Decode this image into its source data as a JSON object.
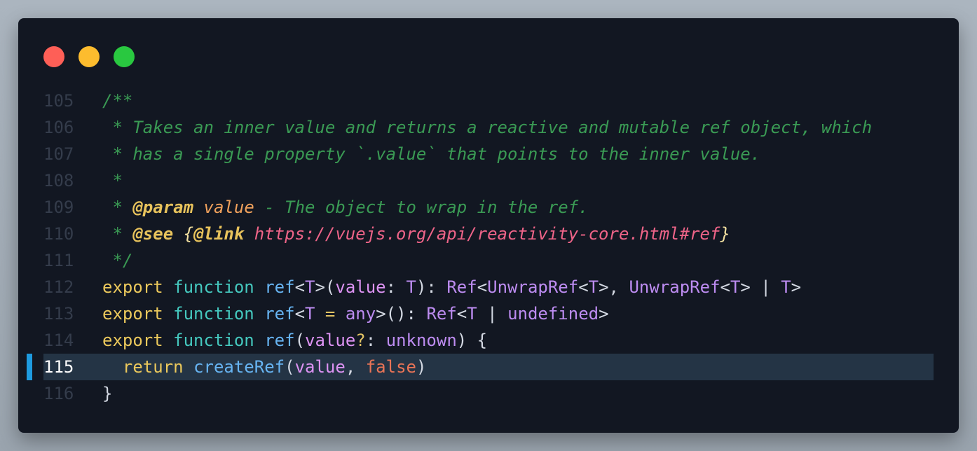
{
  "window": {
    "controls": [
      "close",
      "minimize",
      "maximize"
    ],
    "active_line": 115
  },
  "colors": {
    "background": "#121722",
    "line_highlight": "#243445",
    "gutter_marker": "#1e9be0",
    "comment": "#3a9a54",
    "keyword": "#ecc95c",
    "storage": "#45c9bf",
    "function": "#67b4f2",
    "type": "#bd8cf1",
    "variable": "#dd93f3",
    "boolean": "#ea7456",
    "url": "#ee6488"
  },
  "lines": [
    {
      "number": "105",
      "tokens": [
        {
          "text": "/**",
          "kind": "comment"
        }
      ]
    },
    {
      "number": "106",
      "tokens": [
        {
          "text": " * Takes an inner value and returns a reactive and mutable ref object, which",
          "kind": "comment"
        }
      ]
    },
    {
      "number": "107",
      "tokens": [
        {
          "text": " * has a single property `.value` that points to the inner value.",
          "kind": "comment"
        }
      ]
    },
    {
      "number": "108",
      "tokens": [
        {
          "text": " *",
          "kind": "comment"
        }
      ]
    },
    {
      "number": "109",
      "tokens": [
        {
          "text": " * ",
          "kind": "comment"
        },
        {
          "text": "@param",
          "kind": "doctag"
        },
        {
          "text": " ",
          "kind": "comment"
        },
        {
          "text": "value",
          "kind": "param"
        },
        {
          "text": " - The object to wrap in the ref.",
          "kind": "comment"
        }
      ]
    },
    {
      "number": "110",
      "tokens": [
        {
          "text": " * ",
          "kind": "comment"
        },
        {
          "text": "@see",
          "kind": "doctag"
        },
        {
          "text": " ",
          "kind": "comment"
        },
        {
          "text": "{",
          "kind": "brace"
        },
        {
          "text": "@link",
          "kind": "doctag"
        },
        {
          "text": " ",
          "kind": "comment"
        },
        {
          "text": "https://vuejs.org/api/reactivity-core.html#ref",
          "kind": "url"
        },
        {
          "text": "}",
          "kind": "brace"
        }
      ]
    },
    {
      "number": "111",
      "tokens": [
        {
          "text": " */",
          "kind": "comment"
        }
      ]
    },
    {
      "number": "112",
      "tokens": [
        {
          "text": "export",
          "kind": "keyword"
        },
        {
          "text": " ",
          "kind": "plain"
        },
        {
          "text": "function",
          "kind": "storage"
        },
        {
          "text": " ",
          "kind": "plain"
        },
        {
          "text": "ref",
          "kind": "func"
        },
        {
          "text": "<",
          "kind": "punct"
        },
        {
          "text": "T",
          "kind": "type"
        },
        {
          "text": ">(",
          "kind": "punct"
        },
        {
          "text": "value",
          "kind": "var"
        },
        {
          "text": ": ",
          "kind": "punct"
        },
        {
          "text": "T",
          "kind": "type"
        },
        {
          "text": "): ",
          "kind": "punct"
        },
        {
          "text": "Ref",
          "kind": "type"
        },
        {
          "text": "<",
          "kind": "punct"
        },
        {
          "text": "UnwrapRef",
          "kind": "type"
        },
        {
          "text": "<",
          "kind": "punct"
        },
        {
          "text": "T",
          "kind": "type"
        },
        {
          "text": ">, ",
          "kind": "punct"
        },
        {
          "text": "UnwrapRef",
          "kind": "type"
        },
        {
          "text": "<",
          "kind": "punct"
        },
        {
          "text": "T",
          "kind": "type"
        },
        {
          "text": "> | ",
          "kind": "punct"
        },
        {
          "text": "T",
          "kind": "type"
        },
        {
          "text": ">",
          "kind": "punct"
        }
      ]
    },
    {
      "number": "113",
      "tokens": [
        {
          "text": "export",
          "kind": "keyword"
        },
        {
          "text": " ",
          "kind": "plain"
        },
        {
          "text": "function",
          "kind": "storage"
        },
        {
          "text": " ",
          "kind": "plain"
        },
        {
          "text": "ref",
          "kind": "func"
        },
        {
          "text": "<",
          "kind": "punct"
        },
        {
          "text": "T",
          "kind": "type"
        },
        {
          "text": " ",
          "kind": "plain"
        },
        {
          "text": "=",
          "kind": "op"
        },
        {
          "text": " ",
          "kind": "plain"
        },
        {
          "text": "any",
          "kind": "type"
        },
        {
          "text": ">(): ",
          "kind": "punct"
        },
        {
          "text": "Ref",
          "kind": "type"
        },
        {
          "text": "<",
          "kind": "punct"
        },
        {
          "text": "T",
          "kind": "type"
        },
        {
          "text": " | ",
          "kind": "punct"
        },
        {
          "text": "undefined",
          "kind": "type"
        },
        {
          "text": ">",
          "kind": "punct"
        }
      ]
    },
    {
      "number": "114",
      "tokens": [
        {
          "text": "export",
          "kind": "keyword"
        },
        {
          "text": " ",
          "kind": "plain"
        },
        {
          "text": "function",
          "kind": "storage"
        },
        {
          "text": " ",
          "kind": "plain"
        },
        {
          "text": "ref",
          "kind": "func"
        },
        {
          "text": "(",
          "kind": "punct"
        },
        {
          "text": "value",
          "kind": "var"
        },
        {
          "text": "?",
          "kind": "op"
        },
        {
          "text": ": ",
          "kind": "punct"
        },
        {
          "text": "unknown",
          "kind": "type"
        },
        {
          "text": ") {",
          "kind": "punct"
        }
      ]
    },
    {
      "number": "115",
      "tokens": [
        {
          "text": "  ",
          "kind": "plain"
        },
        {
          "text": "return",
          "kind": "keyword"
        },
        {
          "text": " ",
          "kind": "plain"
        },
        {
          "text": "createRef",
          "kind": "func"
        },
        {
          "text": "(",
          "kind": "punct"
        },
        {
          "text": "value",
          "kind": "var"
        },
        {
          "text": ", ",
          "kind": "punct"
        },
        {
          "text": "false",
          "kind": "bool"
        },
        {
          "text": ")",
          "kind": "punct"
        }
      ]
    },
    {
      "number": "116",
      "tokens": [
        {
          "text": "}",
          "kind": "punct"
        }
      ]
    }
  ]
}
